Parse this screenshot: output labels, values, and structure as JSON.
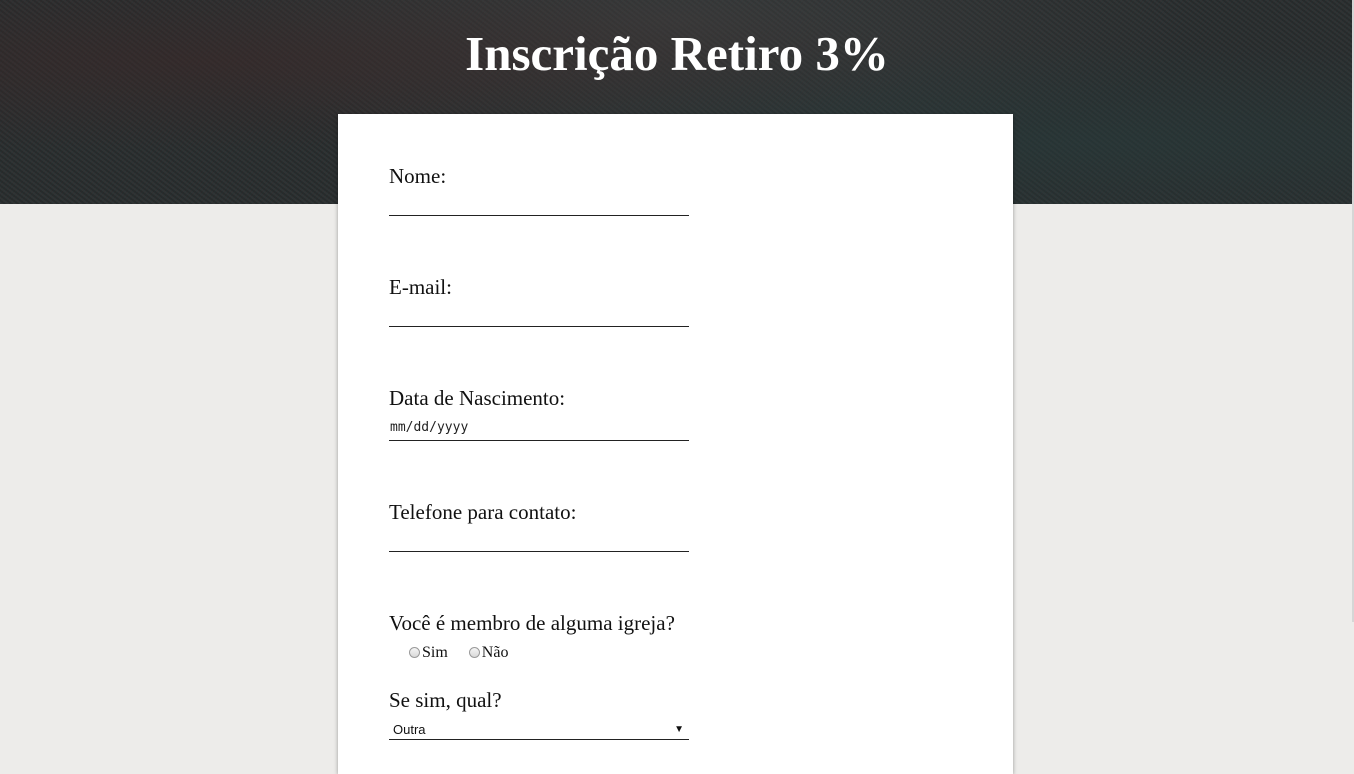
{
  "header": {
    "title": "Inscrição Retiro 3%"
  },
  "form": {
    "nome": {
      "label": "Nome:",
      "value": ""
    },
    "email": {
      "label": "E-mail:",
      "value": ""
    },
    "nascimento": {
      "label": "Data de Nascimento:",
      "placeholder": "mm/dd/yyyy"
    },
    "telefone": {
      "label": "Telefone para contato:",
      "value": ""
    },
    "membro": {
      "label": "Você é membro de alguma igreja?",
      "options": [
        "Sim",
        "Não"
      ]
    },
    "igreja": {
      "label": "Se sim, qual?",
      "selected": "Outra"
    }
  },
  "icons": {
    "select_arrow": "triangle-down-icon"
  }
}
